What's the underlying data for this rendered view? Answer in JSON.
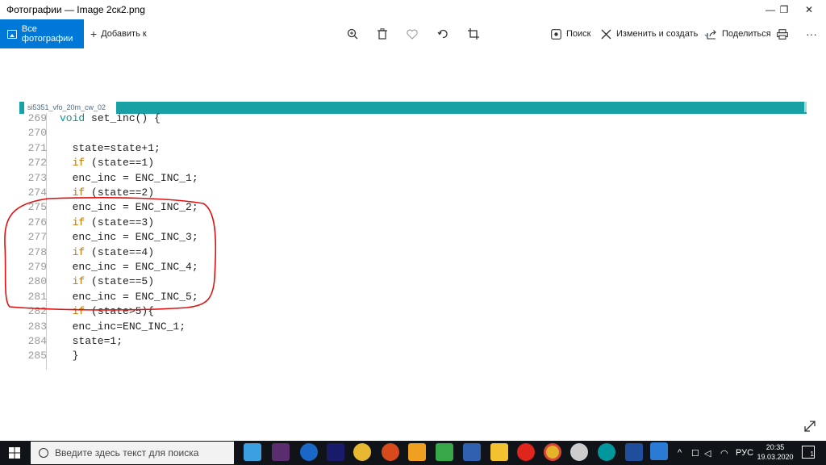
{
  "window": {
    "title": "Фотографии — Image 2ск2.png",
    "minimize": "—",
    "restore": "❐",
    "close": "✕"
  },
  "toolbar": {
    "all_photos": "Все фотографии",
    "add_to": "Добавить к",
    "search": "Поиск",
    "edit_create": "Изменить и создать",
    "share": "Поделиться",
    "more": "···"
  },
  "icons": {
    "zoom": "zoom-in-icon",
    "delete": "trash-icon",
    "favorite": "heart-icon",
    "rotate": "rotate-icon",
    "crop": "crop-icon",
    "print": "printer-icon",
    "expand": "expand-icon"
  },
  "sketch": {
    "tab_name": "si5351_vfo_20m_cw_02"
  },
  "code_lines": [
    {
      "num": "269",
      "text": "void set_inc() {"
    },
    {
      "num": "270",
      "text": ""
    },
    {
      "num": "271",
      "text": "  state=state+1;"
    },
    {
      "num": "272",
      "text": "  if (state==1)"
    },
    {
      "num": "273",
      "text": "  enc_inc = ENC_INC_1;"
    },
    {
      "num": "274",
      "text": "  if (state==2)"
    },
    {
      "num": "275",
      "text": "  enc_inc = ENC_INC_2;"
    },
    {
      "num": "276",
      "text": "  if (state==3)"
    },
    {
      "num": "277",
      "text": "  enc_inc = ENC_INC_3;"
    },
    {
      "num": "278",
      "text": "  if (state==4)"
    },
    {
      "num": "279",
      "text": "  enc_inc = ENC_INC_4;"
    },
    {
      "num": "280",
      "text": "  if (state==5)"
    },
    {
      "num": "281",
      "text": "  enc_inc = ENC_INC_5;"
    },
    {
      "num": "282",
      "text": "  if (state>5){"
    },
    {
      "num": "283",
      "text": "  enc_inc=ENC_INC_1;"
    },
    {
      "num": "284",
      "text": "  state=1;"
    },
    {
      "num": "285",
      "text": "  }"
    }
  ],
  "taskbar": {
    "search_placeholder": "Введите здесь текст для поиска",
    "language": "РУС",
    "time": "20:35",
    "date": "19.03.2020",
    "notifications": "1"
  },
  "colors": {
    "accent": "#0078d7",
    "sketch_bar": "#17a1a5",
    "annotation": "#e01010",
    "keyword": "#c77700"
  }
}
